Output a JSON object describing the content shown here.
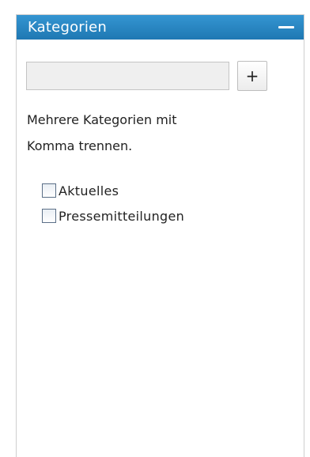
{
  "panel": {
    "title": "Kategorien",
    "collapse_icon": "minus-icon"
  },
  "add_category": {
    "input_value": "",
    "button_label": "+"
  },
  "hint": {
    "line1": "Mehrere Kategorien mit",
    "line2": "Komma trennen."
  },
  "categories": [
    {
      "label": "Aktuelles",
      "checked": false
    },
    {
      "label": "Pressemitteilungen",
      "checked": false
    }
  ],
  "colors": {
    "header": "#2a86c2",
    "header_text": "#ffffff",
    "checkbox_border": "#5b6f87"
  }
}
